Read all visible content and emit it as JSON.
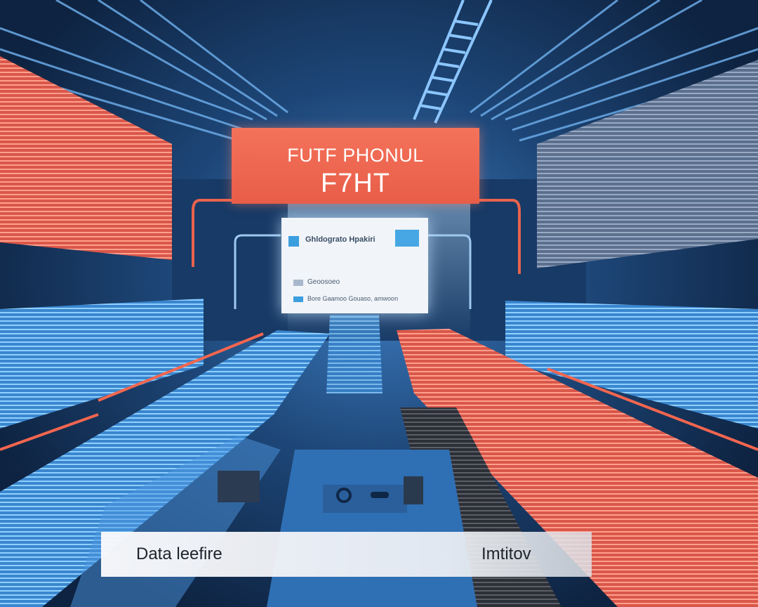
{
  "banner": {
    "line1": "FUTF PHONUL",
    "line2": "F7HT"
  },
  "panel": {
    "title": "Ghldograto Hpakiri",
    "row1": "Geoosoeo",
    "row2": "Bore Gaamoo Gouaso, amwoon"
  },
  "bottom_bar": {
    "left_label": "Data leefire",
    "right_label": "Imtitov"
  },
  "colors": {
    "accent_red": "#e85d48",
    "accent_blue": "#3b9ede",
    "background_dark": "#0e2341"
  }
}
